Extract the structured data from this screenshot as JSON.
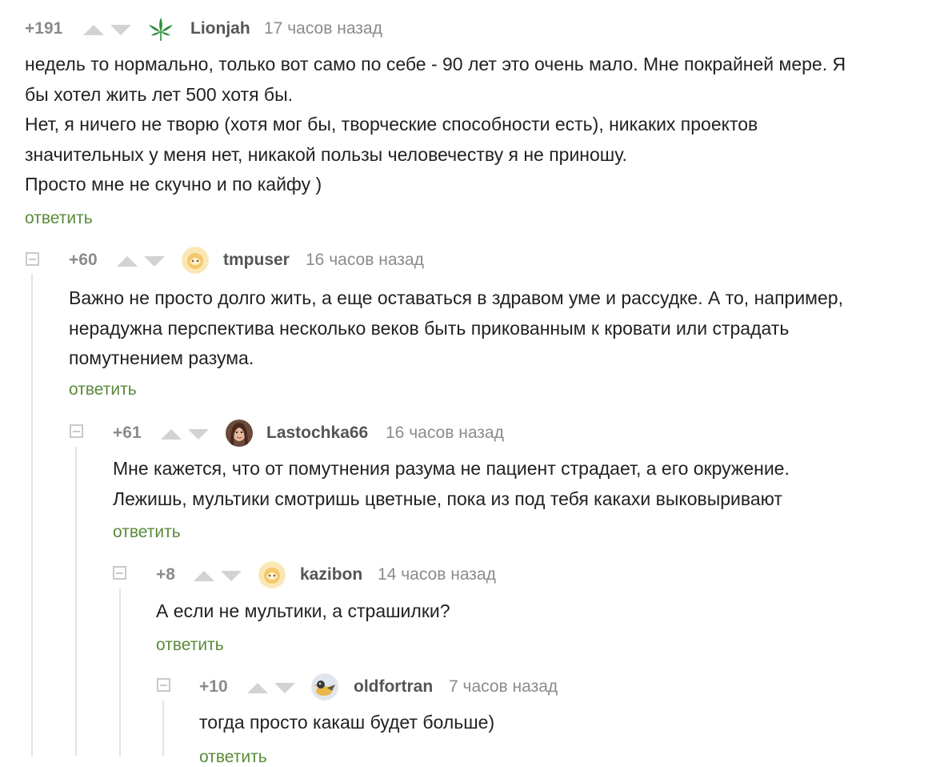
{
  "comments": [
    {
      "rating": "+191",
      "username": "Lionjah",
      "time": "17 часов назад",
      "avatar_icon": "cannabis-leaf-icon",
      "lines": [
        "недель то нормально, только вот само по себе - 90 лет это очень мало. Мне покрайней мере. Я",
        "бы хотел жить лет 500 хотя бы.",
        "Нет, я ничего не творю (хотя мог бы, творческие способности есть), никаких проектов",
        "значительных у меня нет, никакой пользы человечеству я не приношу.",
        "Просто мне не скучно и по кайфу )"
      ],
      "reply": "ответить"
    },
    {
      "rating": "+60",
      "username": "tmpuser",
      "time": "16 часов назад",
      "avatar_icon": "default-avatar-icon",
      "lines": [
        "Важно не просто долго жить, а еще оставаться в здравом уме и рассудке. А то, например,",
        "нерадужна перспектива несколько веков быть прикованным к кровати или страдать",
        "помутнением разума."
      ],
      "reply": "ответить"
    },
    {
      "rating": "+61",
      "username": "Lastochka66",
      "time": "16 часов назад",
      "avatar_icon": "user-photo-avatar-icon",
      "lines": [
        "Мне кажется, что от помутнения разума не пациент страдает, а его окружение.",
        "Лежишь, мультики смотришь цветные, пока из под тебя какахи выковыривают"
      ],
      "reply": "ответить"
    },
    {
      "rating": "+8",
      "username": "kazibon",
      "time": "14 часов назад",
      "avatar_icon": "default-avatar-icon",
      "lines": [
        "А если не мультики, а страшилки?"
      ],
      "reply": "ответить"
    },
    {
      "rating": "+10",
      "username": "oldfortran",
      "time": "7 часов назад",
      "avatar_icon": "bird-avatar-icon",
      "lines": [
        "тогда просто какаш будет больше)"
      ],
      "reply": "ответить"
    }
  ],
  "icons": {
    "upvote": "upvote-arrow-icon",
    "downvote": "downvote-arrow-icon",
    "collapse": "collapse-thread-icon"
  },
  "colors": {
    "text": "#222222",
    "meta": "#8b8b8b",
    "username": "#555555",
    "vote_arrow": "#d2d2d2",
    "reply_link": "#5a8a3a",
    "thread_line": "#e4e4e4"
  }
}
